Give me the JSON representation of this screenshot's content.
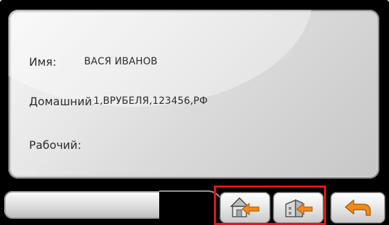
{
  "contact": {
    "name_label": "Имя:",
    "name_value": "ВАСЯ ИВАНОВ",
    "home_label": "Домашний:",
    "home_value": "1,ВРУБЕЛЯ,123456,РФ",
    "work_label": "Рабочий:",
    "work_value": ""
  },
  "toolbar": {
    "import_icon": "house-arrow-left-icon",
    "export_icon": "building-arrow-icon",
    "back_icon": "back-arrow-icon"
  },
  "colors": {
    "highlight": "#e8141b",
    "arrow_orange": "#f08a1c",
    "panel_text": "#2a2a2a"
  }
}
